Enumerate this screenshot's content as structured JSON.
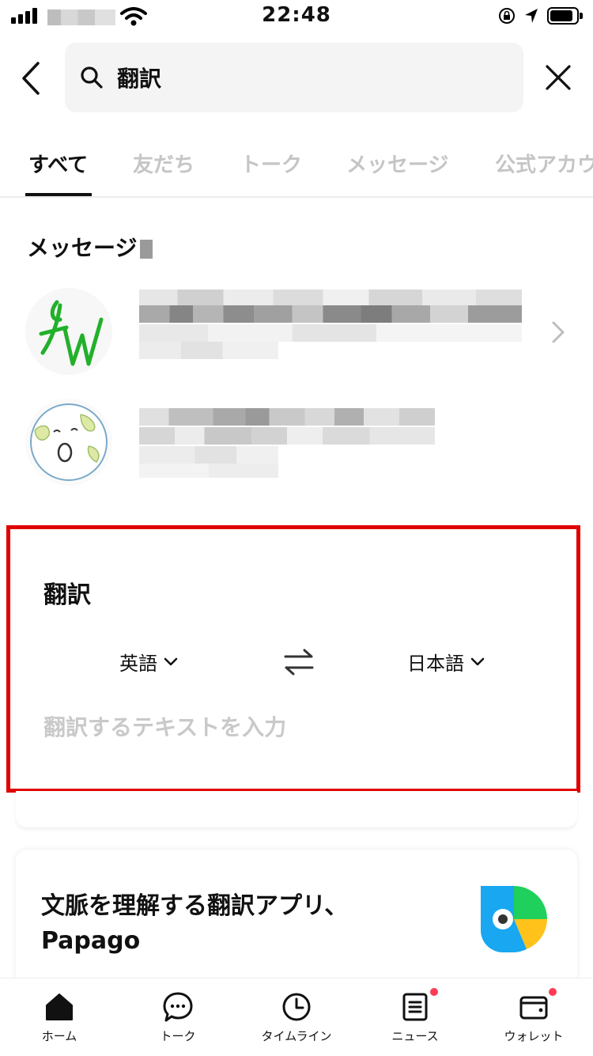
{
  "status_bar": {
    "time": "22:48"
  },
  "search": {
    "query": "翻訳"
  },
  "tabs": [
    {
      "label": "すべて",
      "active": true
    },
    {
      "label": "友だち",
      "active": false
    },
    {
      "label": "トーク",
      "active": false
    },
    {
      "label": "メッセージ",
      "active": false
    },
    {
      "label": "公式アカウ",
      "active": false
    }
  ],
  "messages_section": {
    "title": "メッセージ"
  },
  "translate": {
    "title": "翻訳",
    "source_lang": "英語",
    "target_lang": "日本語",
    "placeholder": "翻訳するテキストを入力"
  },
  "papago": {
    "line1": "文脈を理解する翻訳アプリ、",
    "line2": "Papago"
  },
  "bottom_nav": [
    {
      "label": "ホーム",
      "icon": "home-icon",
      "badge": false
    },
    {
      "label": "トーク",
      "icon": "chat-bubble-icon",
      "badge": false
    },
    {
      "label": "タイムライン",
      "icon": "clock-icon",
      "badge": false
    },
    {
      "label": "ニュース",
      "icon": "news-icon",
      "badge": true
    },
    {
      "label": "ウォレット",
      "icon": "wallet-icon",
      "badge": true
    }
  ],
  "colors": {
    "badge": "#ff3b55",
    "highlight": "#e00000",
    "tab_inactive": "#c5c5c5"
  }
}
